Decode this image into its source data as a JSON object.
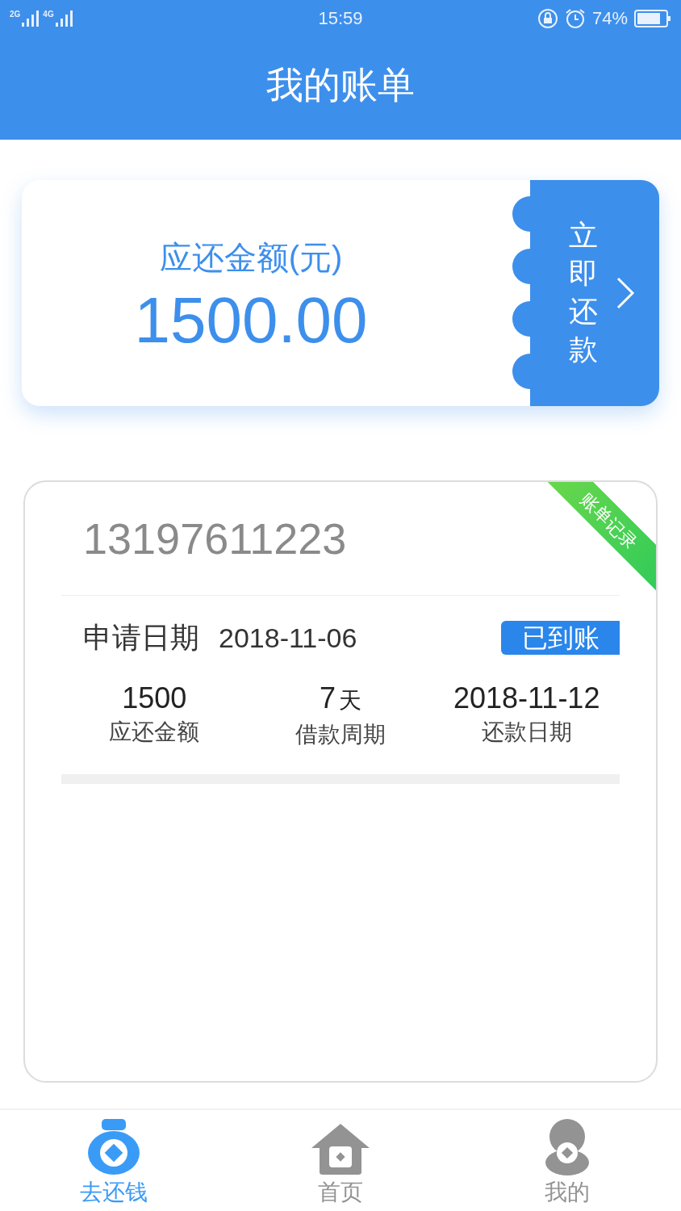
{
  "status_bar": {
    "signal_labels": [
      "2G",
      "4G"
    ],
    "time": "15:59",
    "battery": "74%"
  },
  "header": {
    "title": "我的账单"
  },
  "repay_card": {
    "label": "应还金额(元)",
    "amount": "1500.00",
    "button": "立即还款"
  },
  "bill": {
    "phone": "13197611223",
    "ribbon": "账单记录",
    "date_label": "申请日期",
    "date": "2018-11-06",
    "status": "已到账",
    "stats": [
      {
        "value": "1500",
        "label": "应还金额"
      },
      {
        "value": "7",
        "unit": "天",
        "label": "借款周期"
      },
      {
        "value": "2018-11-12",
        "label": "还款日期"
      }
    ]
  },
  "nav": [
    {
      "label": "去还钱",
      "kind": "bag",
      "selected": true
    },
    {
      "label": "首页",
      "kind": "home",
      "selected": false
    },
    {
      "label": "我的",
      "kind": "user",
      "selected": false
    }
  ]
}
